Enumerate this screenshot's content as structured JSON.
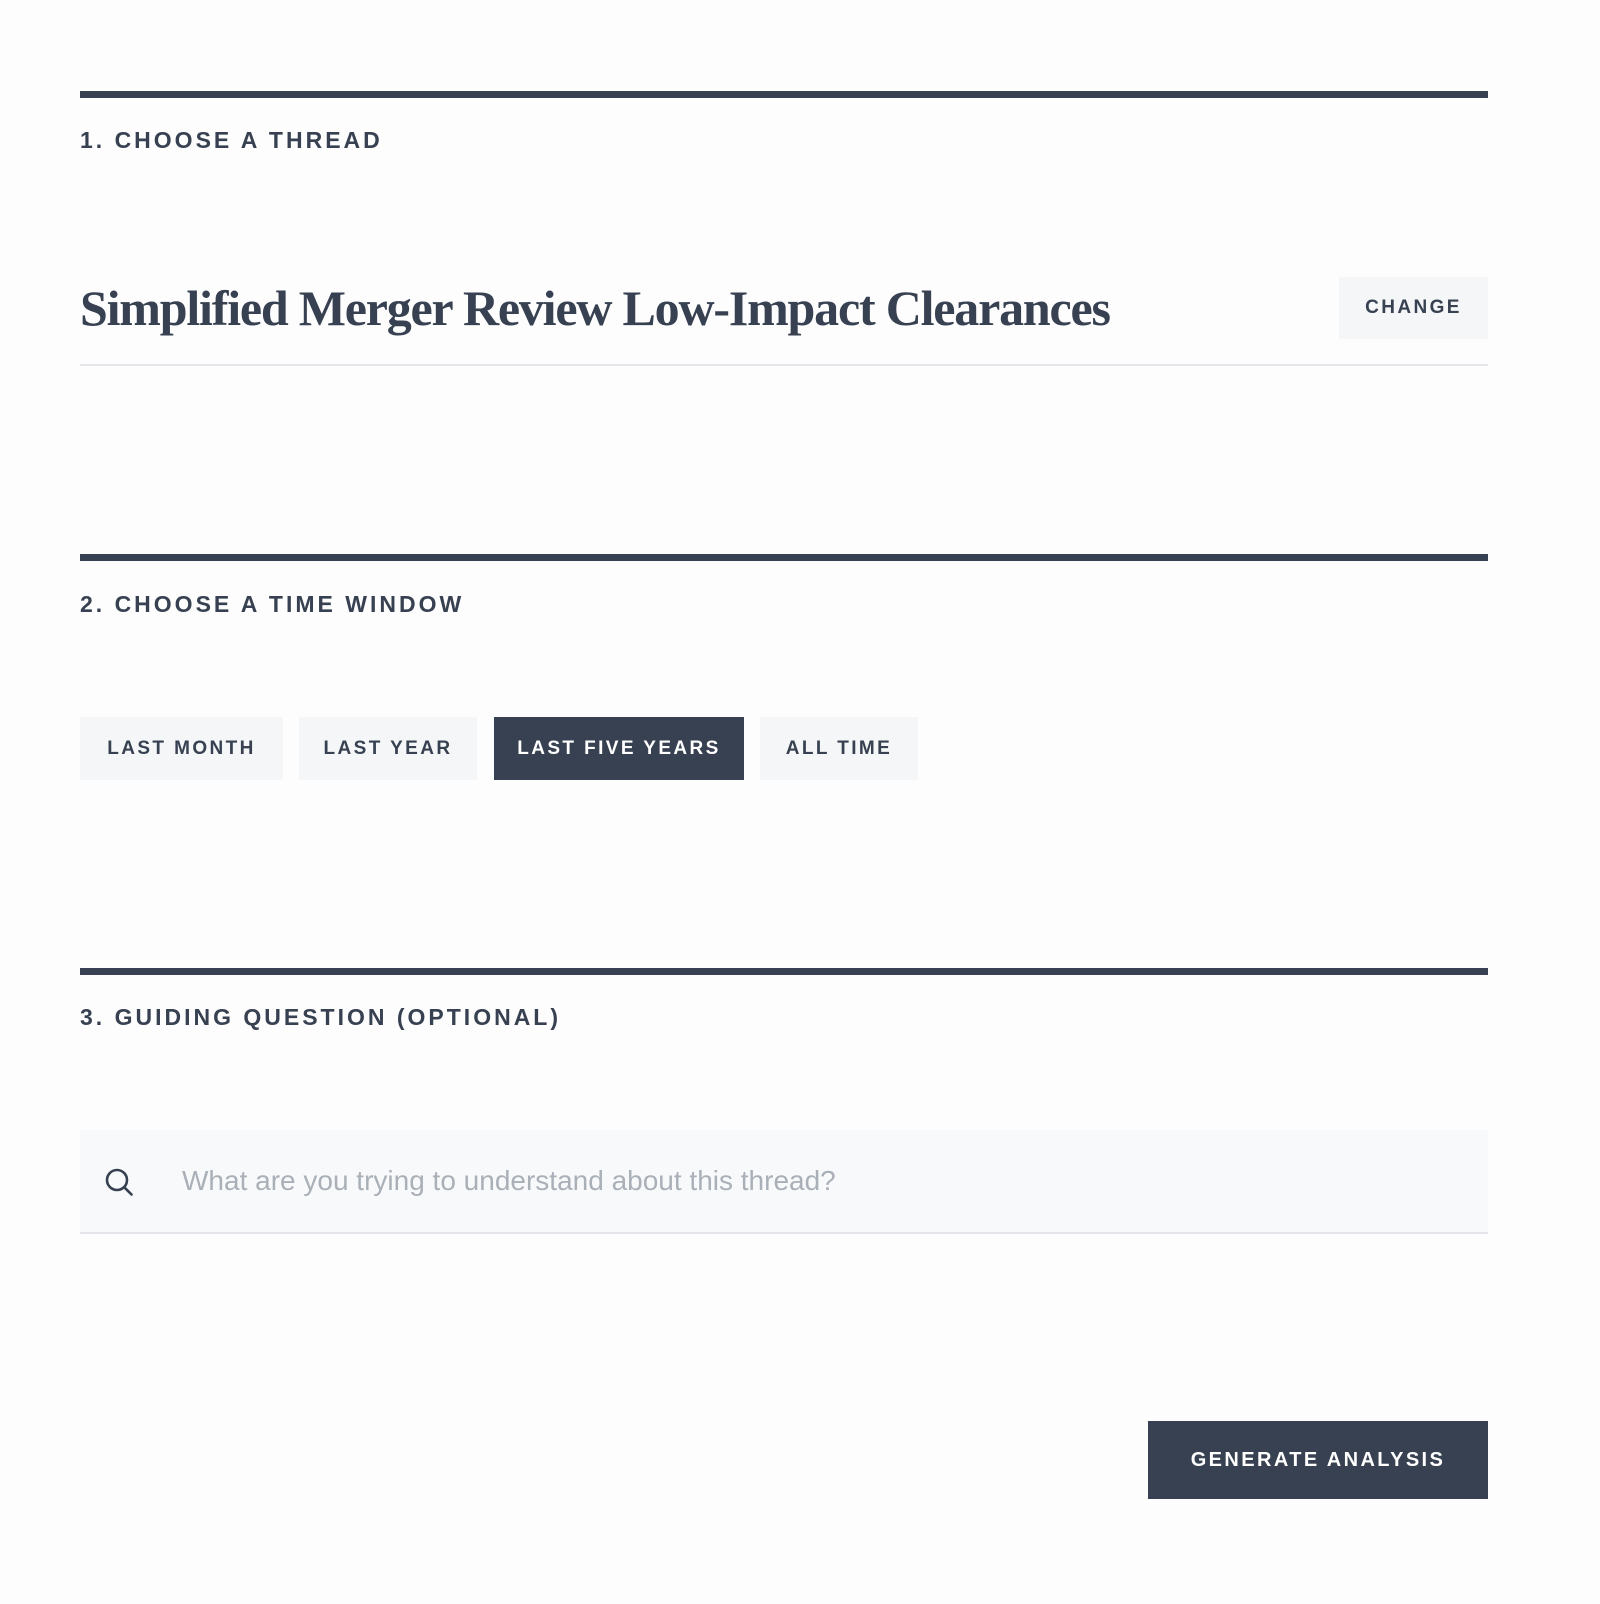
{
  "sections": {
    "thread": {
      "label": "1. CHOOSE A THREAD",
      "selected_title": "Simplified Merger Review Low-Impact Clearances",
      "change_label": "CHANGE"
    },
    "time_window": {
      "label": "2. CHOOSE A TIME WINDOW",
      "options": [
        {
          "label": "LAST MONTH",
          "selected": false
        },
        {
          "label": "LAST YEAR",
          "selected": false
        },
        {
          "label": "LAST FIVE YEARS",
          "selected": true
        },
        {
          "label": "ALL TIME",
          "selected": false
        }
      ]
    },
    "guiding_question": {
      "label": "3. GUIDING QUESTION (OPTIONAL)",
      "value": "",
      "placeholder": "What are you trying to understand about this thread?",
      "icon": "search-icon"
    }
  },
  "actions": {
    "generate_label": "GENERATE ANALYSIS"
  },
  "colors": {
    "accent": "#374151",
    "light_button_bg": "#f5f6f7",
    "search_bg": "#f8f9fa",
    "placeholder": "#aab0b8"
  }
}
